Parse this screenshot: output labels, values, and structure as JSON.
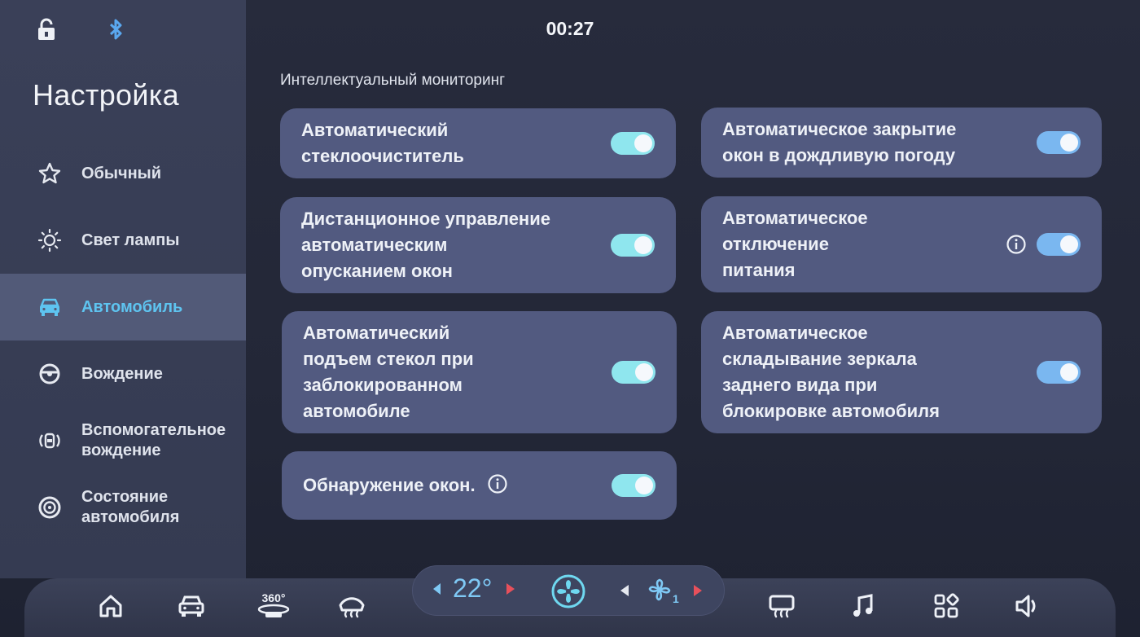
{
  "status": {
    "time": "00:27",
    "icons": [
      "lock-open-icon",
      "bluetooth-icon"
    ]
  },
  "sidebar": {
    "title": "Настройка",
    "items": [
      {
        "label": "Обычный",
        "icon": "star-icon",
        "active": false
      },
      {
        "label": "Свет лампы",
        "icon": "sun-icon",
        "active": false
      },
      {
        "label": "Автомобиль",
        "icon": "car-icon",
        "active": true
      },
      {
        "label": "Вождение",
        "icon": "steering-wheel-icon",
        "active": false
      },
      {
        "label": "Вспомогательное\nвождение",
        "icon": "assist-driving-icon",
        "active": false
      },
      {
        "label": "Состояние\nавтомобиля",
        "icon": "tire-icon",
        "active": false
      }
    ]
  },
  "main": {
    "section_title": "Интеллектуальный мониторинг",
    "settings": [
      {
        "label": "Автоматический\nстеклоочиститель",
        "enabled": true
      },
      {
        "label": "Автоматическое закрытие\nокон в дождливую погоду",
        "enabled": true
      },
      {
        "label": "Дистанционное управление\nавтоматическим\nопусканием окон",
        "enabled": true
      },
      {
        "label": "Автоматическое\nотключение\nпитания",
        "enabled": true,
        "info": true
      },
      {
        "label": "Автоматический\nподъем стекол при\nзаблокированном\nавтомобиле",
        "enabled": true
      },
      {
        "label": "Автоматическое\nскладывание зеркала\nзаднего вида при\nблокировке автомобиля",
        "enabled": true
      },
      {
        "label": "Обнаружение окон.",
        "enabled": true,
        "info": true
      }
    ]
  },
  "dock": {
    "temperature": "22°",
    "fan_level": "1",
    "label_360": "360°",
    "icons": [
      "home-icon",
      "car-icon",
      "360-view-icon",
      "front-defrost-icon",
      "fan-icon",
      "rear-defrost-icon",
      "music-icon",
      "apps-icon",
      "volume-icon"
    ]
  },
  "colors": {
    "accent": "#5ec4f0",
    "toggle_on": "#8fe6ee",
    "card": "#525a80",
    "arrow_red": "#e8505b"
  }
}
